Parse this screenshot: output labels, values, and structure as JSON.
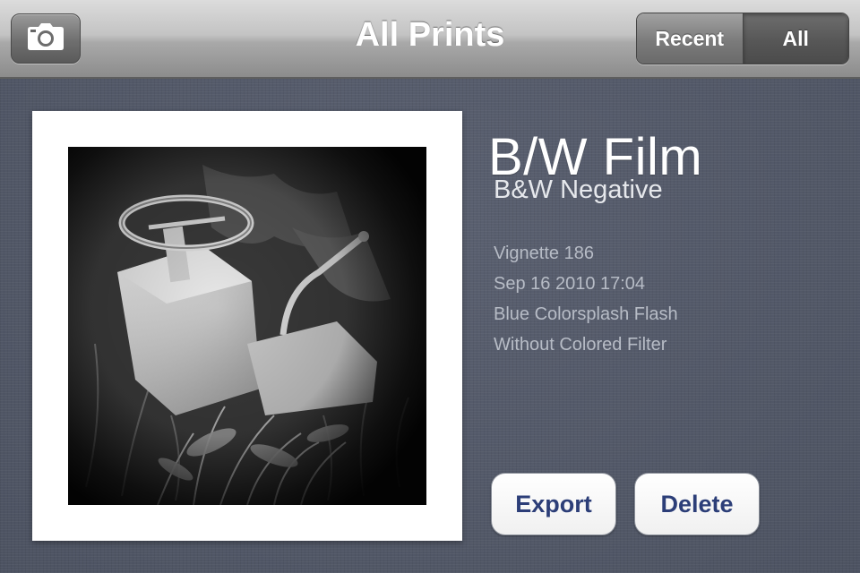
{
  "navbar": {
    "title": "All Prints",
    "camera_icon": "camera-icon",
    "segments": {
      "recent_label": "Recent",
      "all_label": "All",
      "selected": "All"
    }
  },
  "print": {
    "film_name": "B/W Film",
    "film_type": "B&W Negative",
    "details": [
      "Vignette 186",
      "Sep 16 2010 17:04",
      "Blue Colorsplash Flash",
      "Without Colored Filter"
    ]
  },
  "actions": {
    "export_label": "Export",
    "delete_label": "Delete"
  },
  "colors": {
    "background_linen": "#515766",
    "button_text": "#2c3e78",
    "navbar_top": "#dcdcdc",
    "navbar_bottom": "#8c8c8c"
  }
}
